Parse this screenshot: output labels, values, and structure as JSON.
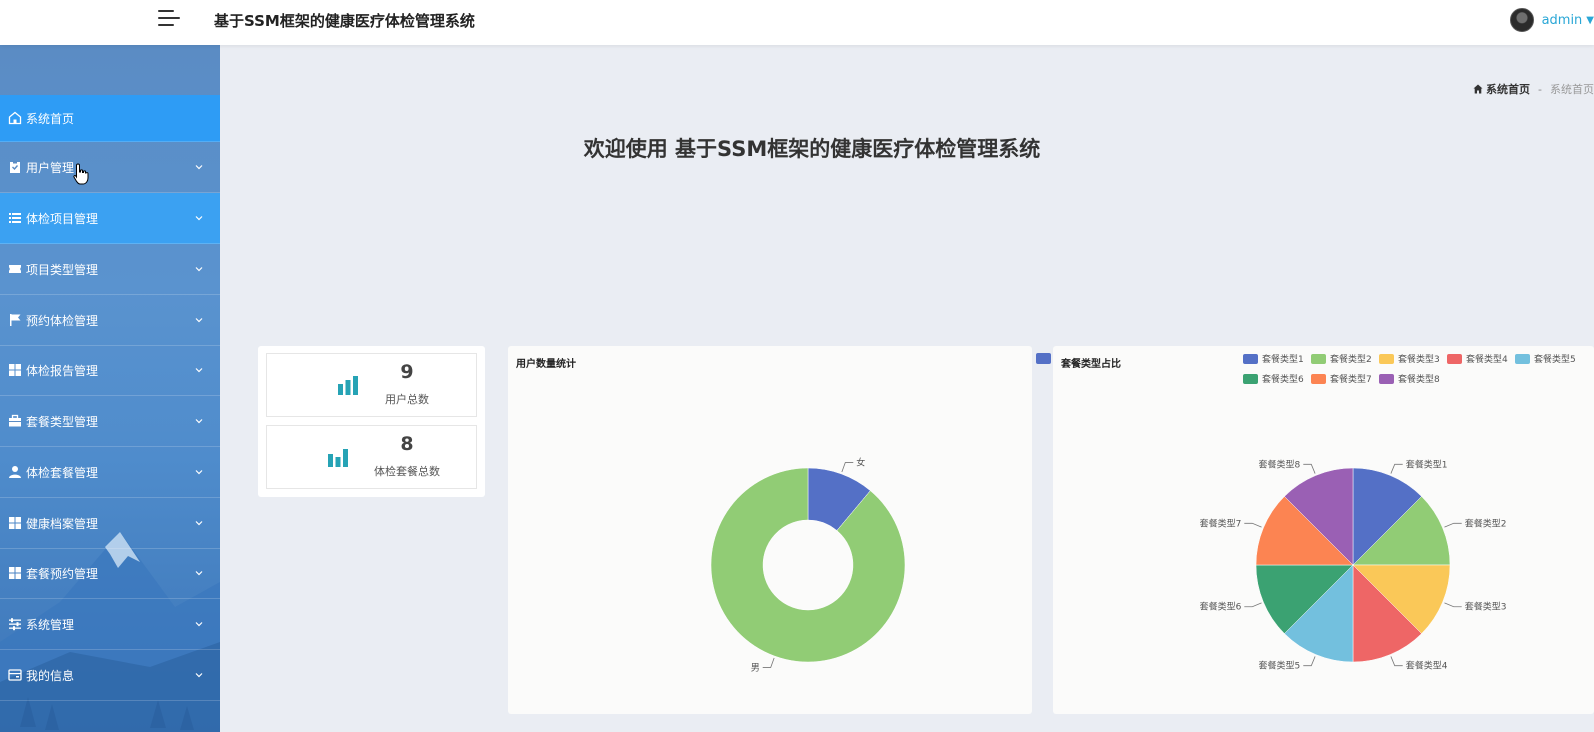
{
  "header": {
    "title": "基于SSM框架的健康医疗体检管理系统",
    "username": "admin"
  },
  "sidebar": {
    "items": [
      {
        "label": "系统首页",
        "icon": "home-icon"
      },
      {
        "label": "用户管理",
        "icon": "clipboard-icon"
      },
      {
        "label": "体检项目管理",
        "icon": "list-icon"
      },
      {
        "label": "项目类型管理",
        "icon": "ticket-icon"
      },
      {
        "label": "预约体检管理",
        "icon": "flag-icon"
      },
      {
        "label": "体检报告管理",
        "icon": "grid-icon"
      },
      {
        "label": "套餐类型管理",
        "icon": "briefcase-icon"
      },
      {
        "label": "体检套餐管理",
        "icon": "user-icon"
      },
      {
        "label": "健康档案管理",
        "icon": "grid-icon"
      },
      {
        "label": "套餐预约管理",
        "icon": "grid-icon"
      },
      {
        "label": "系统管理",
        "icon": "sliders-icon"
      },
      {
        "label": "我的信息",
        "icon": "wallet-icon"
      }
    ]
  },
  "breadcrumb": {
    "home": "系统首页",
    "separator": "-",
    "current": "系统首页"
  },
  "welcome": "欢迎使用 基于SSM框架的健康医疗体检管理系统",
  "stats": [
    {
      "value": "9",
      "label": "用户总数"
    },
    {
      "value": "8",
      "label": "体检套餐总数"
    }
  ],
  "colors": {
    "accent": "#2e9cf5",
    "stat_icon": "#26a3b5",
    "palette": [
      "#5470c6",
      "#91cc75",
      "#fac858",
      "#ee6666",
      "#73c0de",
      "#3ba272",
      "#fc8452",
      "#9a60b4"
    ]
  },
  "chart_data": [
    {
      "type": "pie",
      "title": "用户数量统计",
      "donut": true,
      "categories": [
        "女",
        "男"
      ],
      "values": [
        1,
        8
      ]
    },
    {
      "type": "pie",
      "title": "套餐类型占比",
      "legend_position": "top-right",
      "categories": [
        "套餐类型1",
        "套餐类型2",
        "套餐类型3",
        "套餐类型4",
        "套餐类型5",
        "套餐类型6",
        "套餐类型7",
        "套餐类型8"
      ],
      "values": [
        1,
        1,
        1,
        1,
        1,
        1,
        1,
        1
      ]
    }
  ]
}
